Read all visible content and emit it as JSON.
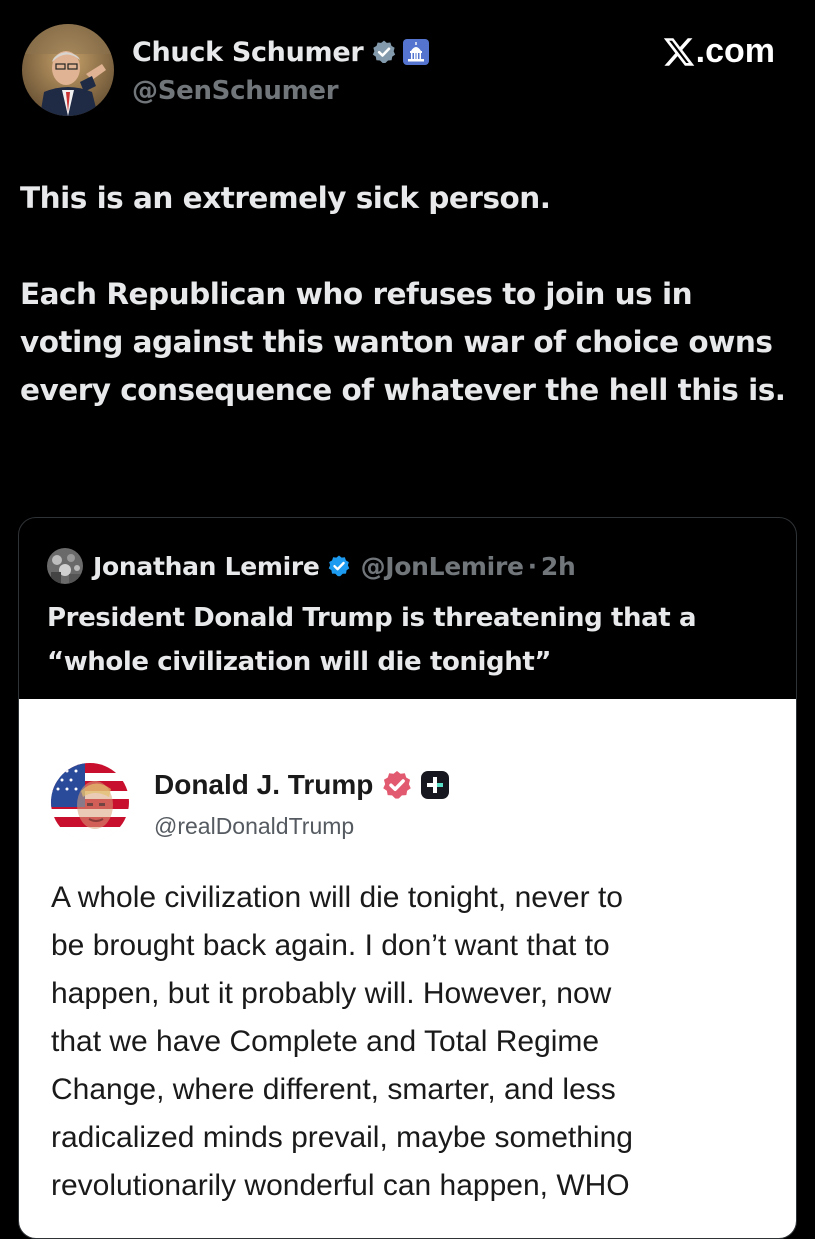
{
  "site": {
    "label": ".com",
    "logo_icon": "x-logo-icon"
  },
  "post": {
    "author_name": "Chuck Schumer",
    "author_handle": "@SenSchumer",
    "verified_icon": "gray-verified-badge-icon",
    "affiliation_icon": "us-capitol-icon",
    "paragraphs": [
      "This is an extremely sick person.",
      "Each Republican who refuses to join us in voting against this wanton war of choice owns every consequence of whatever the hell this is."
    ]
  },
  "quote": {
    "author_name": "Jonathan Lemire",
    "author_handle": "@JonLemire",
    "separator": "·",
    "time": "2h",
    "verified_icon": "blue-verified-badge-icon",
    "text_lines": [
      "President Donald Trump is threatening that a",
      "“whole civilization will die tonight”"
    ]
  },
  "embedded": {
    "author_name": "Donald J. Trump",
    "author_handle": "@realDonaldTrump",
    "verified_icon": "red-verified-badge-icon",
    "plus_icon": "truth-social-plus-icon",
    "text_lines": [
      "A whole civilization will die tonight, never to",
      "be brought back again. I don’t want that to",
      "happen, but it probably will. However, now",
      "that we have Complete and Total Regime",
      "Change, where different, smarter, and less",
      "radicalized minds prevail, maybe something",
      "revolutionarily wonderful can happen, WHO"
    ]
  },
  "colors": {
    "background": "#000000",
    "primary_text": "#e7e9ea",
    "secondary_text": "#71767b",
    "twitter_blue": "#1d9bf0",
    "truth_red": "#e25a6f"
  }
}
